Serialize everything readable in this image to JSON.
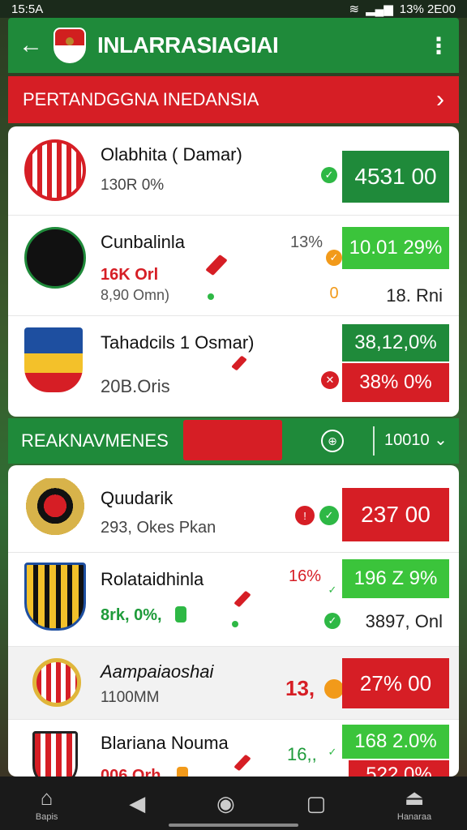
{
  "status_bar": {
    "time": "15:5A",
    "right": "13% 2E00"
  },
  "app_bar": {
    "title": "INLARRASIAGIAI",
    "back_glyph": "←",
    "menu_glyph": "⋮"
  },
  "section1": {
    "title": "PERTANDGGNA INEDANSIA",
    "chevron": "›"
  },
  "matches1": [
    {
      "name": "Olabhita ( Damar)",
      "sub": "130R 0%",
      "value": "4531 00",
      "value_color": "green"
    },
    {
      "name": "Cunbalinla",
      "pct": "13%",
      "sub_red": "16K Orl",
      "sub2": "8,90 Omn)",
      "value": "10.01 29%",
      "value_color": "lime",
      "value2": "18. Rni"
    },
    {
      "name": "Tahadcils 1 Osmar)",
      "sub": "20B.Oris",
      "value": "38,12,0%",
      "value_color": "green",
      "value2": "38% 0%",
      "value2_color": "red"
    }
  ],
  "section2": {
    "title": "REAKNAVMENES",
    "circle_glyph": "⊕",
    "selector": "10010 ⌄"
  },
  "matches2": [
    {
      "name": "Quudarik",
      "sub": "293, Okes Pkan",
      "value": "237 00",
      "value_color": "red"
    },
    {
      "name": "Rolataidhinla",
      "pct": "16%",
      "sub_green": "8rk, 0%,",
      "value": "196 Z 9%",
      "value_color": "lime",
      "value2": "3897, Onl"
    },
    {
      "name": "Aampaiaoshai",
      "sub": "1100MM",
      "pct": "13,",
      "value": "27% 00",
      "value_color": "red"
    },
    {
      "name": "Blariana Nouma",
      "pct": "16,,",
      "sub_red": "006 Orh,",
      "value": "168 2.0%",
      "value_color": "lime",
      "value2": "522 0%",
      "value2_color": "red"
    }
  ],
  "bottom_nav": [
    {
      "glyph": "⌂",
      "label": "Bapis"
    },
    {
      "glyph": "◀",
      "label": ""
    },
    {
      "glyph": "◉",
      "label": ""
    },
    {
      "glyph": "▢",
      "label": ""
    },
    {
      "glyph": "⏏",
      "label": "Hanaraa"
    }
  ],
  "colors": {
    "green": "#1f8a3a",
    "lime": "#3bc43b",
    "red": "#d61e25"
  }
}
